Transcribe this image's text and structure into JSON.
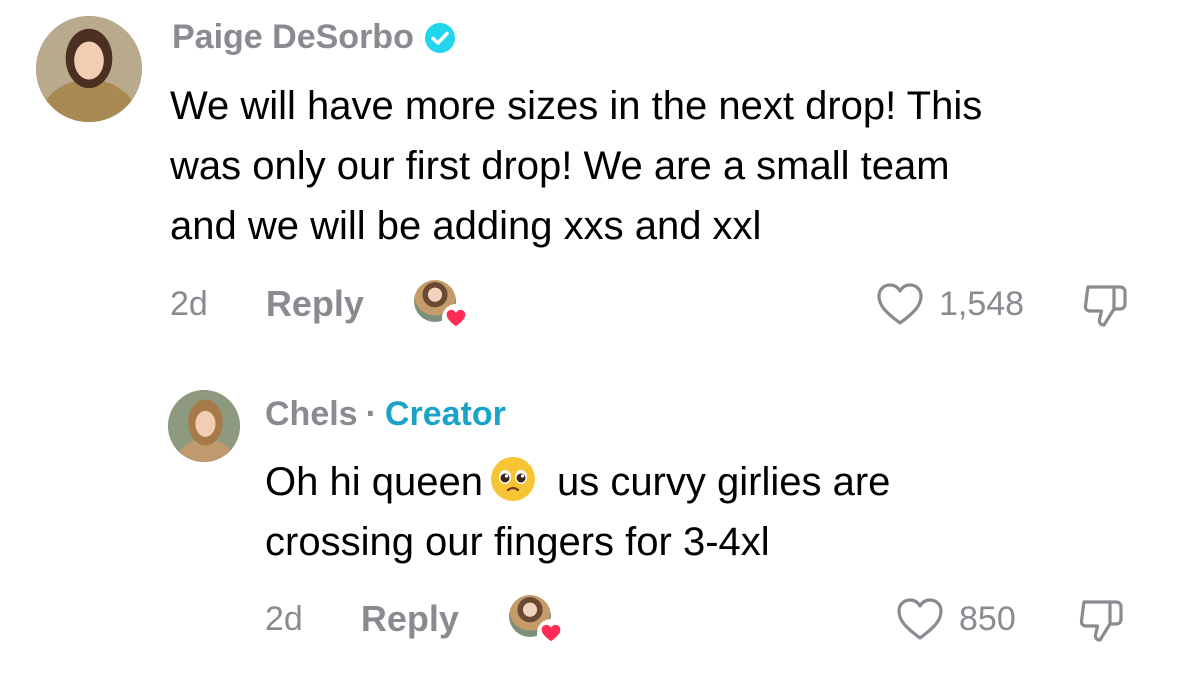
{
  "comments": [
    {
      "username": "Paige DeSorbo",
      "verified": true,
      "lines": [
        "We will have more sizes in the next drop! This",
        "was only our first drop! We are a small team",
        "and we will be adding xxs and xxl"
      ],
      "time": "2d",
      "reply_label": "Reply",
      "like_count": "1,548"
    },
    {
      "username": "Chels",
      "separator": "·",
      "badge": "Creator",
      "line1_before_emoji": "Oh hi queen",
      "line1_after_emoji": "us curvy girlies are",
      "line2": "crossing our fingers for 3-4xl",
      "time": "2d",
      "reply_label": "Reply",
      "like_count": "850"
    }
  ],
  "colors": {
    "muted": "#8a8b91",
    "creator": "#1aa3c9",
    "verified": "#20d5ec",
    "heart": "#fe2c55"
  }
}
